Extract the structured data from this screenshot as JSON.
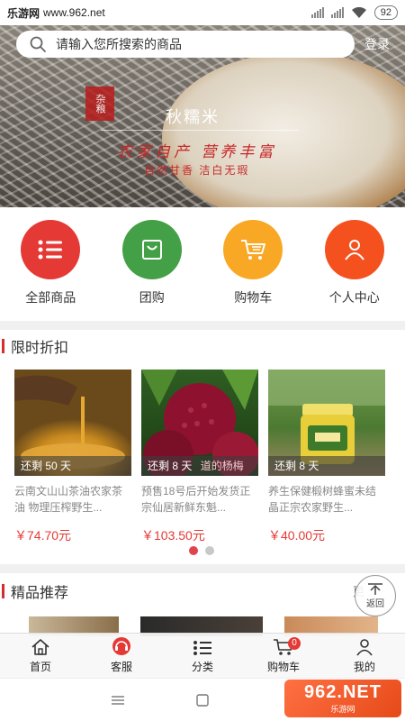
{
  "status_bar": {
    "site_logo": "乐游网",
    "site_url": "www.962.net",
    "battery": "92"
  },
  "header": {
    "search_placeholder": "请输入您所搜索的商品",
    "login_label": "登录"
  },
  "banner": {
    "seal_text": "杂粮",
    "title": "秋糯米",
    "slogan": "农家自产 营养丰富",
    "subtitle": "自然甘香 洁白无瑕"
  },
  "categories": [
    {
      "label": "全部商品",
      "icon": "list-icon",
      "color": "#e53935"
    },
    {
      "label": "团购",
      "icon": "shopping-bag-icon",
      "color": "#43a047"
    },
    {
      "label": "购物车",
      "icon": "cart-icon",
      "color": "#f9a825"
    },
    {
      "label": "个人中心",
      "icon": "user-icon",
      "color": "#f4511e"
    }
  ],
  "flash_sale": {
    "title": "限时折扣",
    "products": [
      {
        "countdown": "还剩 50 天",
        "name": "云南文山山茶油农家茶油 物理压榨野生...",
        "price": "￥74.70元"
      },
      {
        "countdown": "还剩 8 天",
        "name": "预售18号后开始发货正宗仙居新鲜东魁...",
        "price": "￥103.50元",
        "overlay_text": "道的杨梅"
      },
      {
        "countdown": "还剩 8 天",
        "name": "养生保健椴树蜂蜜未结晶正宗农家野生...",
        "price": "￥40.00元"
      }
    ],
    "pager": {
      "active_color": "#e0434b",
      "inactive_color": "#c8c8c8"
    }
  },
  "recommend": {
    "title": "精品推荐",
    "more_label": "更",
    "back_top_label": "返回"
  },
  "tabbar": {
    "items": [
      {
        "label": "首页",
        "icon": "home-icon"
      },
      {
        "label": "客服",
        "icon": "customer-service-icon"
      },
      {
        "label": "分类",
        "icon": "category-icon"
      },
      {
        "label": "购物车",
        "icon": "cart-icon",
        "badge": "0"
      },
      {
        "label": "我的",
        "icon": "user-icon"
      }
    ]
  },
  "watermark": {
    "main": "962.NET",
    "sub": "乐游网"
  },
  "colors": {
    "accent": "#d32f2f",
    "price": "#e53935"
  }
}
